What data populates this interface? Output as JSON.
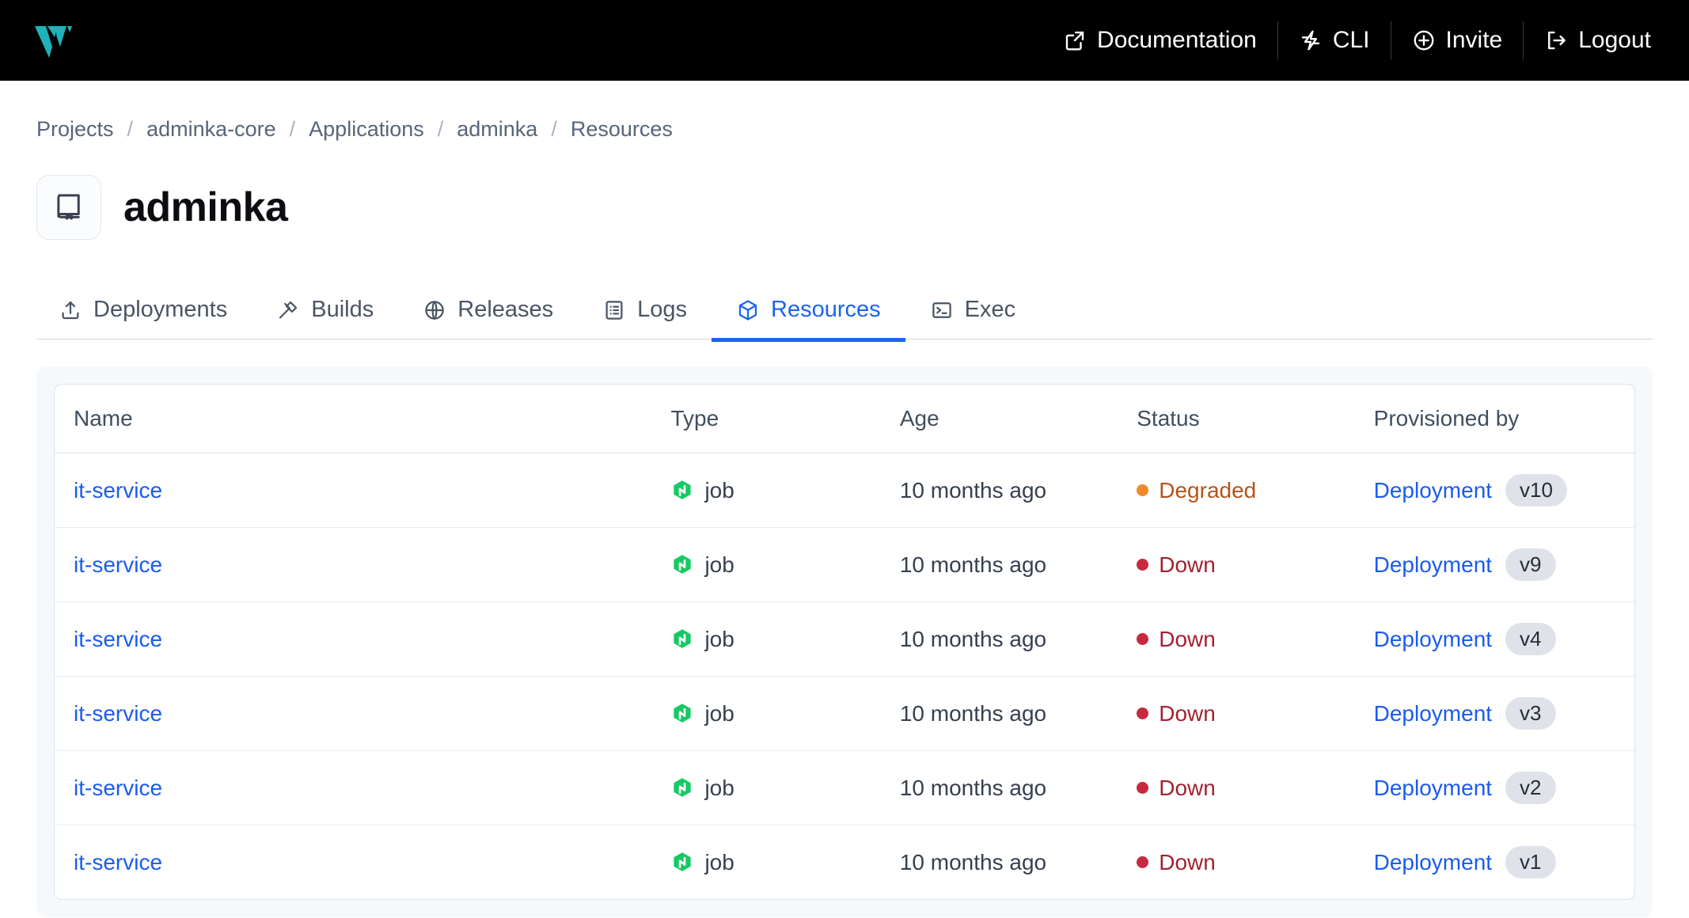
{
  "topbar": {
    "logo_name": "logo-mark",
    "logo_color": "#20B2B8",
    "background": "#000000",
    "nav": [
      {
        "label": "Documentation",
        "icon": "external-link-icon"
      },
      {
        "label": "CLI",
        "icon": "lightning-bolt-icon"
      },
      {
        "label": "Invite",
        "icon": "plus-circle-icon"
      },
      {
        "label": "Logout",
        "icon": "sign-out-icon"
      }
    ]
  },
  "breadcrumb": {
    "separator": "/",
    "items": [
      {
        "label": "Projects"
      },
      {
        "label": "adminka-core"
      },
      {
        "label": "Applications"
      },
      {
        "label": "adminka"
      },
      {
        "label": "Resources"
      }
    ]
  },
  "app": {
    "title": "adminka",
    "icon": "book-icon"
  },
  "tabs": {
    "active": "Resources",
    "items": [
      {
        "label": "Deployments",
        "icon": "upload-icon",
        "active": false
      },
      {
        "label": "Builds",
        "icon": "hammer-icon",
        "active": false
      },
      {
        "label": "Releases",
        "icon": "globe-icon",
        "active": false
      },
      {
        "label": "Logs",
        "icon": "list-document-icon",
        "active": false
      },
      {
        "label": "Resources",
        "icon": "cube-icon",
        "active": true
      },
      {
        "label": "Exec",
        "icon": "terminal-icon",
        "active": false
      }
    ],
    "active_color": "#1A64F0"
  },
  "resources_table": {
    "columns": [
      "Name",
      "Type",
      "Age",
      "Status",
      "Provisioned by"
    ],
    "rows": [
      {
        "name": "it-service",
        "type": "job",
        "type_icon": "job-hexagon-icon",
        "age": "10 months ago",
        "status": "Degraded",
        "status_color": "#F0892A",
        "provisioned_by": "Deployment",
        "version": "v10"
      },
      {
        "name": "it-service",
        "type": "job",
        "type_icon": "job-hexagon-icon",
        "age": "10 months ago",
        "status": "Down",
        "status_color": "#C72A3E",
        "provisioned_by": "Deployment",
        "version": "v9"
      },
      {
        "name": "it-service",
        "type": "job",
        "type_icon": "job-hexagon-icon",
        "age": "10 months ago",
        "status": "Down",
        "status_color": "#C72A3E",
        "provisioned_by": "Deployment",
        "version": "v4"
      },
      {
        "name": "it-service",
        "type": "job",
        "type_icon": "job-hexagon-icon",
        "age": "10 months ago",
        "status": "Down",
        "status_color": "#C72A3E",
        "provisioned_by": "Deployment",
        "version": "v3"
      },
      {
        "name": "it-service",
        "type": "job",
        "type_icon": "job-hexagon-icon",
        "age": "10 months ago",
        "status": "Down",
        "status_color": "#C72A3E",
        "provisioned_by": "Deployment",
        "version": "v2"
      },
      {
        "name": "it-service",
        "type": "job",
        "type_icon": "job-hexagon-icon",
        "age": "10 months ago",
        "status": "Down",
        "status_color": "#C72A3E",
        "provisioned_by": "Deployment",
        "version": "v1"
      }
    ]
  }
}
